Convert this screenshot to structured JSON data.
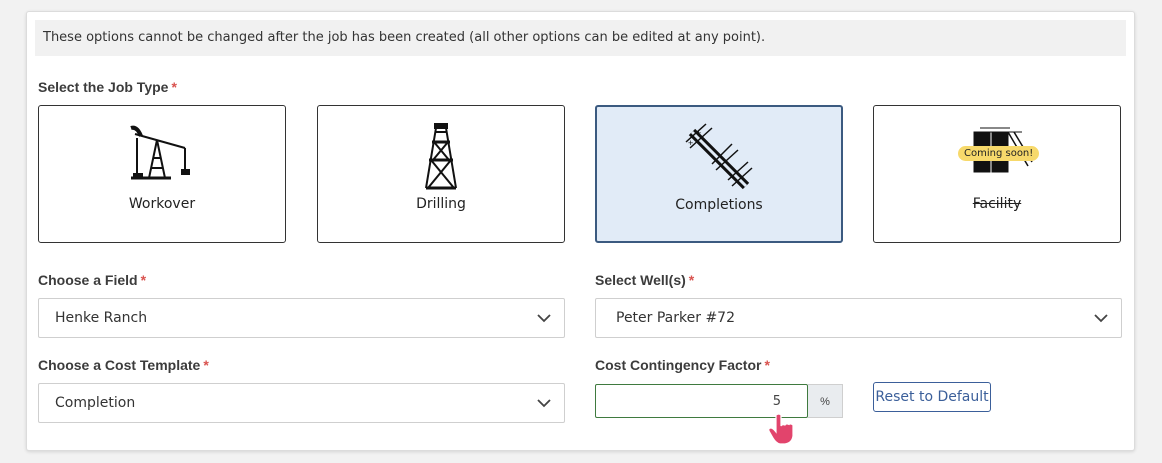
{
  "notice": "These options cannot be changed after the job has been created (all other options can be edited at any point).",
  "required_mark": "*",
  "job_type": {
    "label": "Select the Job Type",
    "options": [
      {
        "label": "Workover",
        "icon": "pumpjack-icon"
      },
      {
        "label": "Drilling",
        "icon": "derrick-icon"
      },
      {
        "label": "Completions",
        "icon": "completion-pipe-icon",
        "selected": true
      },
      {
        "label": "Facility",
        "icon": "facility-icon",
        "disabled": true,
        "badge": "Coming soon!"
      }
    ]
  },
  "field": {
    "label": "Choose a Field",
    "value": "Henke Ranch"
  },
  "wells": {
    "label": "Select Well(s)",
    "value": "Peter Parker #72"
  },
  "cost_template": {
    "label": "Choose a Cost Template",
    "value": "Completion"
  },
  "contingency": {
    "label": "Cost Contingency Factor",
    "value": "5",
    "suffix": "%"
  },
  "reset_label": "Reset to Default",
  "colors": {
    "selected_bg": "#e1ebf7",
    "selected_border": "#3b5a80",
    "required": "#d9534f",
    "accent": "#3b5f9a",
    "badge": "#f7d96b"
  }
}
